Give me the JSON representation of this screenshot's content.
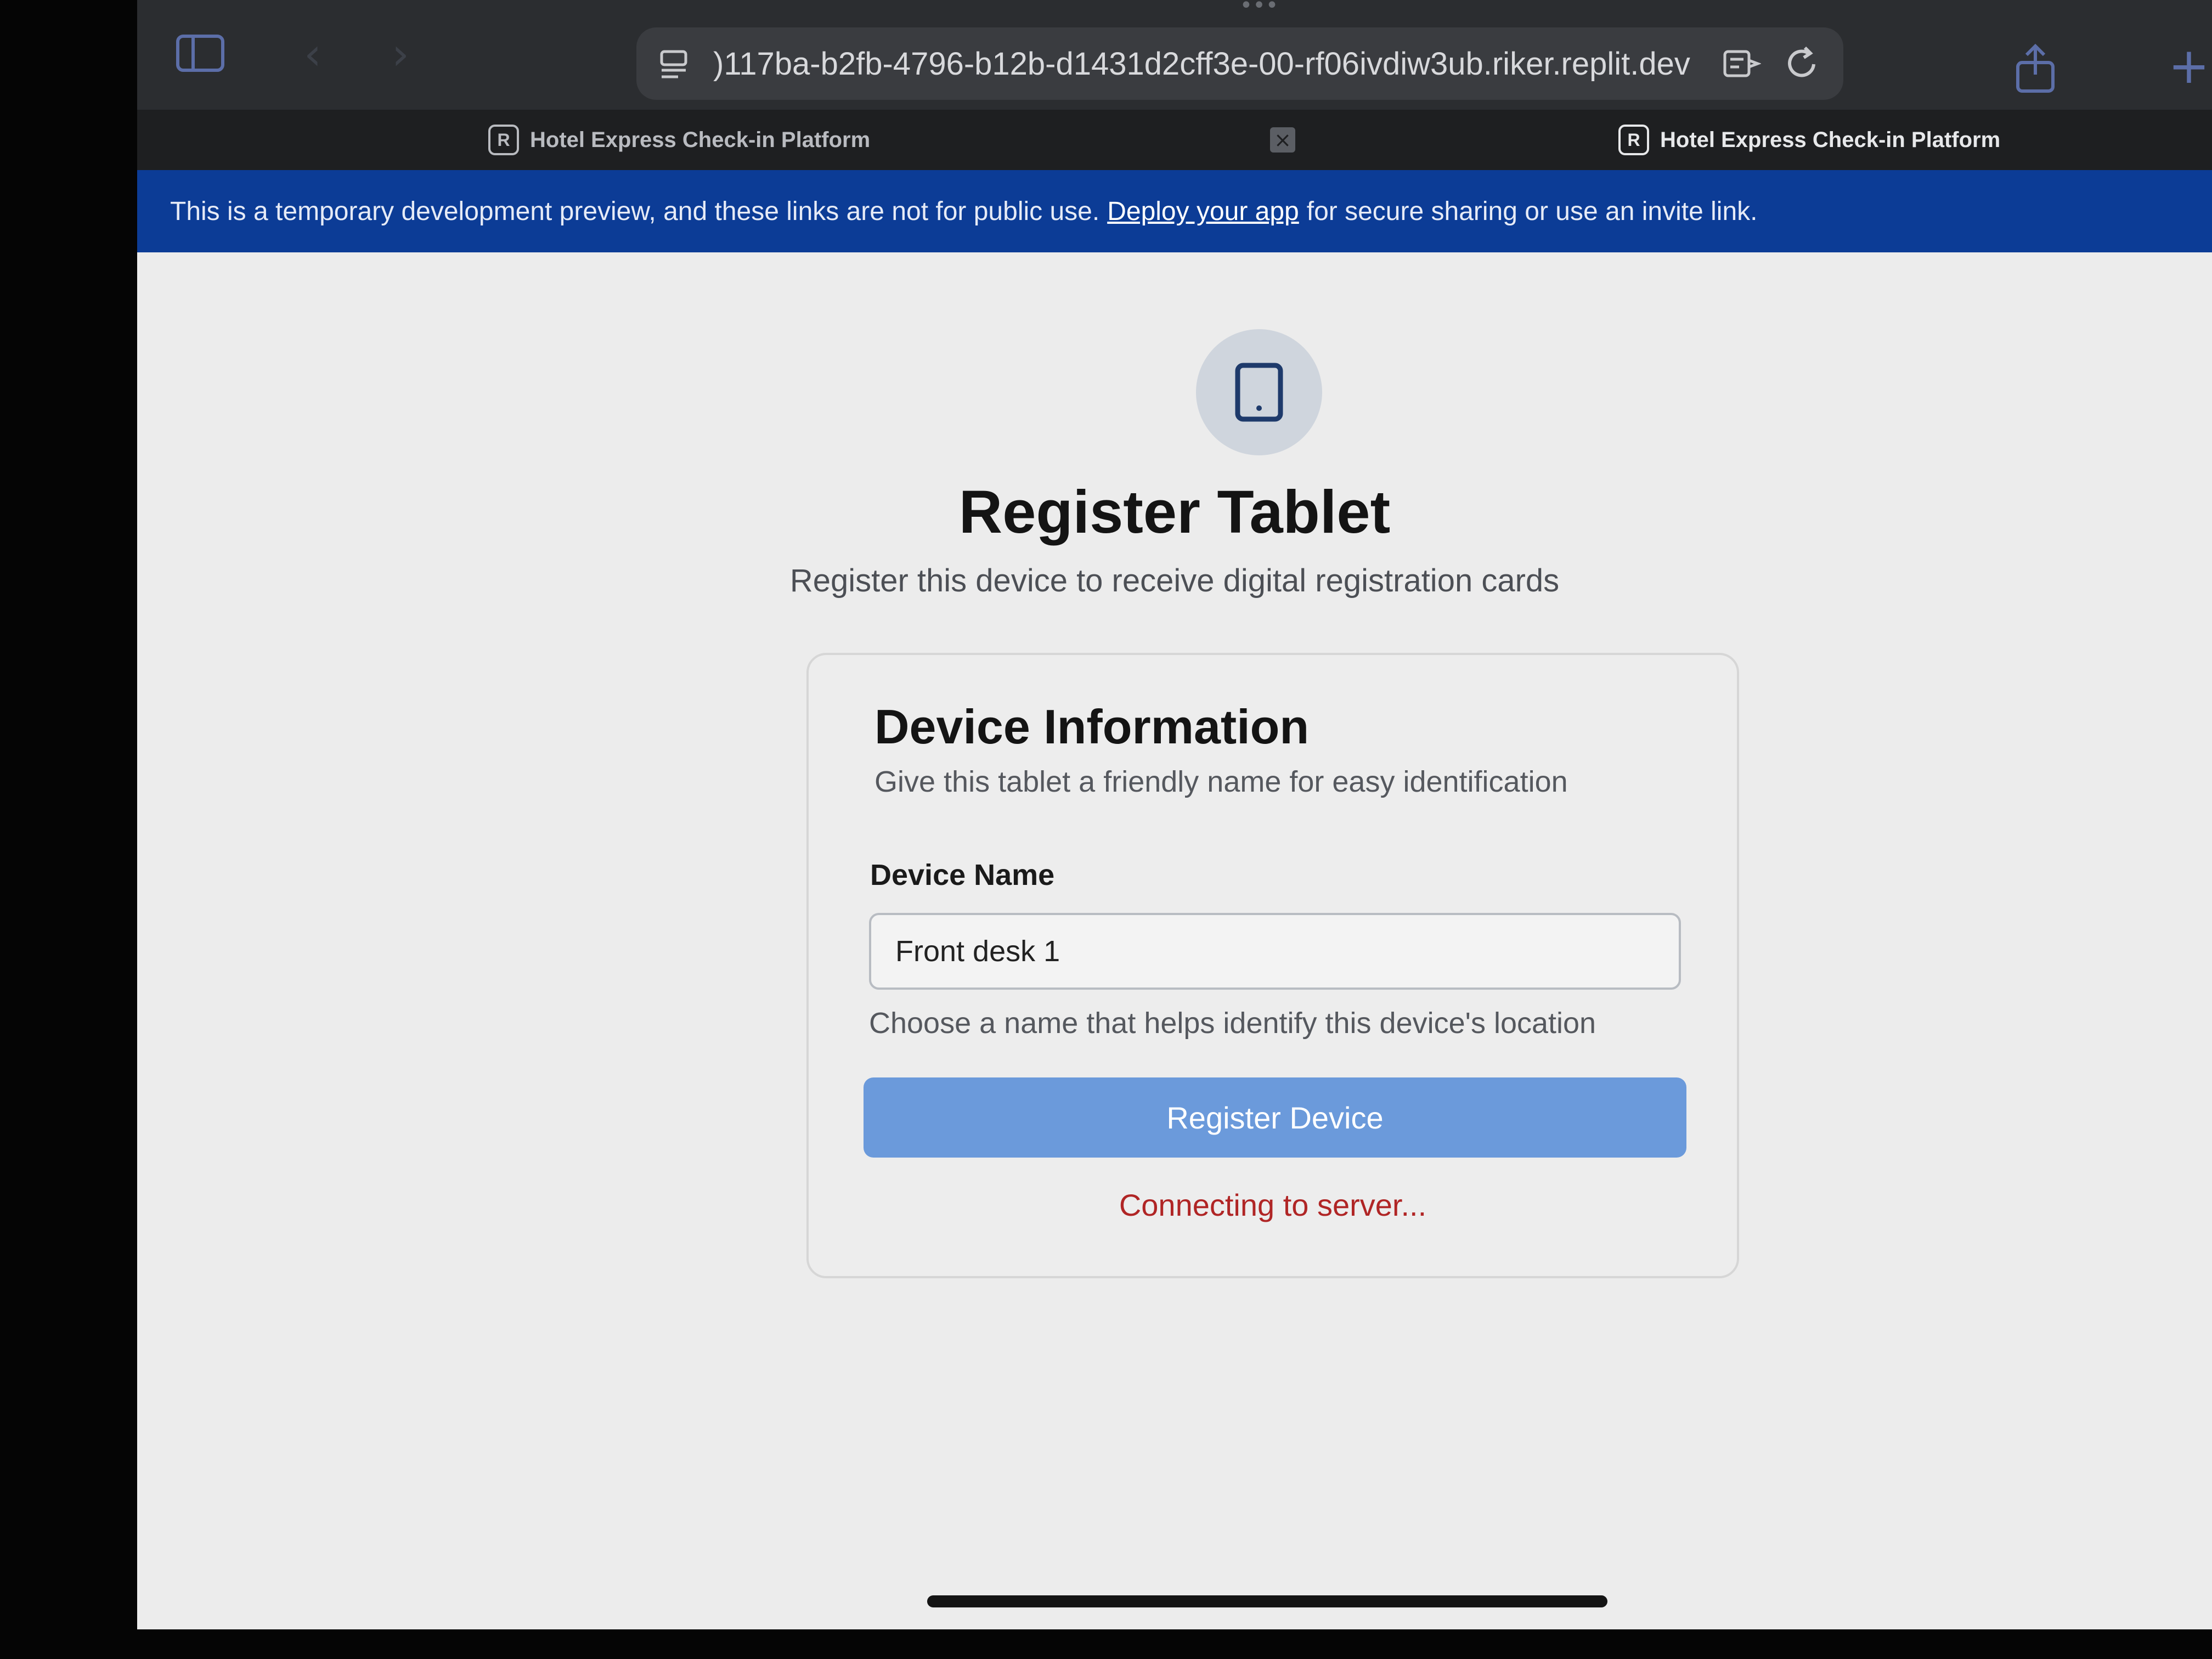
{
  "browser": {
    "url": ")117ba-b2fb-4796-b12b-d1431d2cff3e-00-rf06ivdiw3ub.riker.replit.dev",
    "tabs": [
      {
        "label": "Hotel Express Check-in Platform",
        "logo": "R",
        "active": false
      },
      {
        "label": "Hotel Express Check-in Platform",
        "logo": "R",
        "active": true
      }
    ],
    "icons": {
      "sidebar": "sidebar-toggle-icon",
      "back": "chevron-left-icon",
      "forward": "chevron-right-icon",
      "page_menu": "page-menu-icon",
      "reader": "reader-mode-icon",
      "reload": "reload-icon",
      "share": "share-icon",
      "new_tab": "plus-icon",
      "tab_close": "close-icon"
    }
  },
  "banner": {
    "text_before": "This is a temporary development preview, and these links are not for public use.",
    "link": "Deploy your app",
    "text_after": "for secure sharing or use an invite link.",
    "color": "#0c3c96"
  },
  "page": {
    "icon": "tablet-icon",
    "title": "Register Tablet",
    "subtitle": "Register this device to receive digital registration cards"
  },
  "card": {
    "title": "Device Information",
    "description": "Give this tablet a friendly name for easy identification",
    "field_label": "Device Name",
    "field_value": "Front desk 1",
    "field_help": "Choose a name that helps identify this device's location",
    "button_label": "Register Device",
    "status": "Connecting to server..."
  },
  "colors": {
    "accent_button": "#6b9adb",
    "status_error": "#b02525"
  }
}
